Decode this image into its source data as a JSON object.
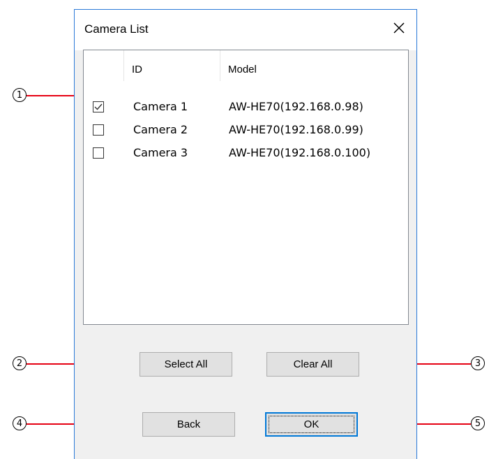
{
  "dialog": {
    "title": "Camera List",
    "close_icon": "close-icon"
  },
  "list": {
    "columns": [
      "ID",
      "Model"
    ],
    "rows": [
      {
        "checked": true,
        "id": "Camera 1",
        "model": "AW-HE70(192.168.0.98)"
      },
      {
        "checked": false,
        "id": "Camera 2",
        "model": "AW-HE70(192.168.0.99)"
      },
      {
        "checked": false,
        "id": "Camera 3",
        "model": "AW-HE70(192.168.0.100)"
      }
    ]
  },
  "buttons": {
    "select_all": "Select All",
    "clear_all": "Clear All",
    "back": "Back",
    "ok": "OK"
  },
  "callouts": [
    "1",
    "2",
    "3",
    "4",
    "5"
  ],
  "colors": {
    "callout_line": "#e60012",
    "window_border": "#2b79d8",
    "default_button_border": "#0078d7"
  }
}
